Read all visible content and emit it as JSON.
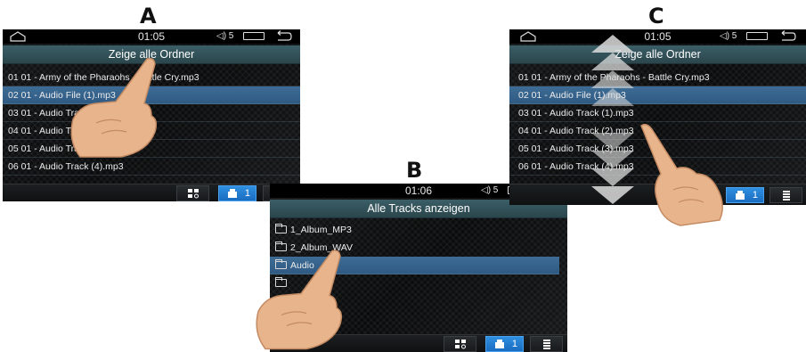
{
  "labels": {
    "a": "A",
    "b": "B",
    "c": "C"
  },
  "screen_a": {
    "time": "01:05",
    "volume": "◁) 5",
    "title": "Zeige alle Ordner",
    "rows": [
      "01 01 - Army of the Pharaohs - Battle Cry.mp3",
      "02 01 - Audio File (1).mp3",
      "03 01 - Audio Track (1).mp3",
      "04 01 - Audio Track (2).mp3",
      "05 01 - Audio Track (3).mp3",
      "06 01 - Audio Track (4).mp3"
    ],
    "selected_row": 1,
    "usb_count": "1"
  },
  "screen_b": {
    "time": "01:06",
    "volume": "◁) 5",
    "title": "Alle Tracks anzeigen",
    "folders": [
      "1_Album_MP3",
      "2_Album_WAV",
      "Audio"
    ],
    "selected_row": 2,
    "usb_count": "1"
  },
  "screen_c": {
    "time": "01:05",
    "volume": "◁) 5",
    "title": "Zeige alle Ordner",
    "rows": [
      "01 01 - Army of the Pharaohs - Battle Cry.mp3",
      "02 01 - Audio File (1).mp3",
      "03 01 - Audio Track (1).mp3",
      "04 01 - Audio Track (2).mp3",
      "05 01 - Audio Track (3).mp3",
      "06 01 - Audio Track (4).mp3"
    ],
    "selected_row": 1,
    "usb_count": "1"
  },
  "icons": [
    "home-icon",
    "volume-icon",
    "battery-icon",
    "back-icon",
    "grid-icon",
    "usb-icon",
    "equalizer-icon",
    "folder-icon",
    "scroll-up-arrows",
    "scroll-down-arrows",
    "pointing-hand"
  ],
  "colors": {
    "title_bar": "#3b5e67",
    "selection": "#3d6c96",
    "active_button": "#2f8fe0"
  }
}
